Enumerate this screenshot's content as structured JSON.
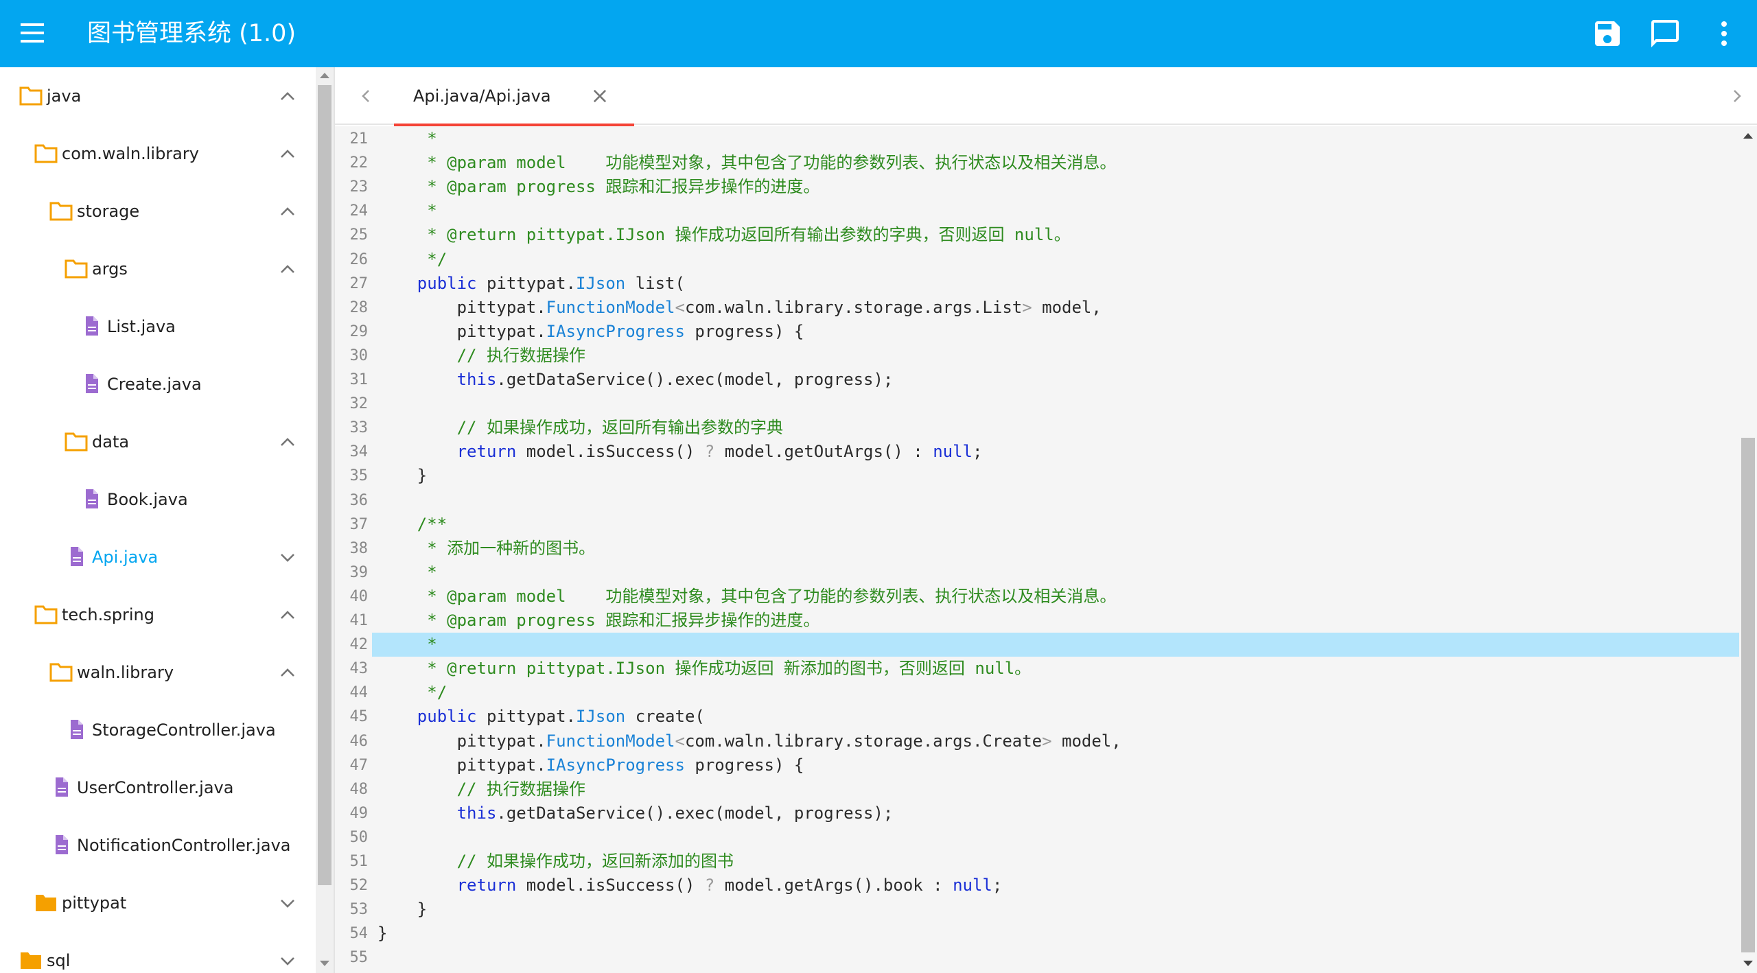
{
  "app": {
    "title": "图书管理系统 (1.0)"
  },
  "toolbar": {
    "icons": [
      "save-icon",
      "comment-icon",
      "more-vert-icon"
    ]
  },
  "tree": [
    {
      "label": "java",
      "kind": "folder",
      "expanded": true
    },
    {
      "label": "com.waln.library",
      "kind": "folder",
      "expanded": true
    },
    {
      "label": "storage",
      "kind": "folder",
      "expanded": true
    },
    {
      "label": "args",
      "kind": "folder",
      "expanded": true
    },
    {
      "label": "List.java",
      "kind": "file"
    },
    {
      "label": "Create.java",
      "kind": "file"
    },
    {
      "label": "data",
      "kind": "folder",
      "expanded": true
    },
    {
      "label": "Book.java",
      "kind": "file"
    },
    {
      "label": "Api.java",
      "kind": "file",
      "active": true
    },
    {
      "label": "tech.spring",
      "kind": "folder",
      "expanded": true
    },
    {
      "label": "waln.library",
      "kind": "folder",
      "expanded": true
    },
    {
      "label": "StorageController.java",
      "kind": "file"
    },
    {
      "label": "UserController.java",
      "kind": "file"
    },
    {
      "label": "NotificationController.java",
      "kind": "file"
    },
    {
      "label": "pittypat",
      "kind": "folder-filled",
      "expanded": false
    },
    {
      "label": "sql",
      "kind": "folder-filled",
      "expanded": false
    }
  ],
  "editor": {
    "tab_label": "Api.java/Api.java",
    "highlight_line": 42,
    "lines": [
      {
        "n": "21",
        "html": "<span class='c-cm'>     *</span>"
      },
      {
        "n": "22",
        "html": "<span class='c-cm'>     * @param model    功能模型对象，其中包含了功能的参数列表、执行状态以及相关消息。</span>"
      },
      {
        "n": "23",
        "html": "<span class='c-cm'>     * @param progress 跟踪和汇报异步操作的进度。</span>"
      },
      {
        "n": "24",
        "html": "<span class='c-cm'>     *</span>"
      },
      {
        "n": "25",
        "html": "<span class='c-cm'>     * @return pittypat.IJson 操作成功返回所有输出参数的字典，否则返回 null。</span>"
      },
      {
        "n": "26",
        "html": "<span class='c-cm'>     */</span>"
      },
      {
        "n": "27",
        "html": "    <span class='c-kw'>public</span> pittypat.<span class='c-ty'>IJson</span> list("
      },
      {
        "n": "28",
        "html": "        pittypat.<span class='c-ty'>FunctionModel</span><span class='c-gr'>&lt;</span>com.waln.library.storage.args.List<span class='c-gr'>&gt;</span> model,"
      },
      {
        "n": "29",
        "html": "        pittypat.<span class='c-ty'>IAsyncProgress</span> progress) {"
      },
      {
        "n": "30",
        "html": "        <span class='c-cm'>// 执行数据操作</span>"
      },
      {
        "n": "31",
        "html": "        <span class='c-kw'>this</span>.getDataService().exec(model, progress);"
      },
      {
        "n": "32",
        "html": ""
      },
      {
        "n": "33",
        "html": "        <span class='c-cm'>// 如果操作成功，返回所有输出参数的字典</span>"
      },
      {
        "n": "34",
        "html": "        <span class='c-kw'>return</span> model.isSuccess() <span class='c-gr'>?</span> model.getOutArgs() : <span class='c-kw'>null</span>;"
      },
      {
        "n": "35",
        "html": "    }"
      },
      {
        "n": "36",
        "html": ""
      },
      {
        "n": "37",
        "html": "<span class='c-cm'>    /**</span>"
      },
      {
        "n": "38",
        "html": "<span class='c-cm'>     * 添加一种新的图书。</span>"
      },
      {
        "n": "39",
        "html": "<span class='c-cm'>     *</span>"
      },
      {
        "n": "40",
        "html": "<span class='c-cm'>     * @param model    功能模型对象，其中包含了功能的参数列表、执行状态以及相关消息。</span>"
      },
      {
        "n": "41",
        "html": "<span class='c-cm'>     * @param progress 跟踪和汇报异步操作的进度。</span>"
      },
      {
        "n": "42",
        "html": "<span class='c-cm'>     *</span>"
      },
      {
        "n": "43",
        "html": "<span class='c-cm'>     * @return pittypat.IJson 操作成功返回 新添加的图书，否则返回 null。</span>"
      },
      {
        "n": "44",
        "html": "<span class='c-cm'>     */</span>"
      },
      {
        "n": "45",
        "html": "    <span class='c-kw'>public</span> pittypat.<span class='c-ty'>IJson</span> create("
      },
      {
        "n": "46",
        "html": "        pittypat.<span class='c-ty'>FunctionModel</span><span class='c-gr'>&lt;</span>com.waln.library.storage.args.Create<span class='c-gr'>&gt;</span> model,"
      },
      {
        "n": "47",
        "html": "        pittypat.<span class='c-ty'>IAsyncProgress</span> progress) {"
      },
      {
        "n": "48",
        "html": "        <span class='c-cm'>// 执行数据操作</span>"
      },
      {
        "n": "49",
        "html": "        <span class='c-kw'>this</span>.getDataService().exec(model, progress);"
      },
      {
        "n": "50",
        "html": ""
      },
      {
        "n": "51",
        "html": "        <span class='c-cm'>// 如果操作成功，返回新添加的图书</span>"
      },
      {
        "n": "52",
        "html": "        <span class='c-kw'>return</span> model.isSuccess() <span class='c-gr'>?</span> model.getArgs().book : <span class='c-kw'>null</span>;"
      },
      {
        "n": "53",
        "html": "    }"
      },
      {
        "n": "54",
        "html": "}"
      },
      {
        "n": "55",
        "html": ""
      }
    ]
  },
  "colors": {
    "appbar": "#03a6f0",
    "folder": "#f5a000",
    "file": "#9c6bd0",
    "active": "#03a6f0",
    "tab_underline": "#f44336"
  }
}
